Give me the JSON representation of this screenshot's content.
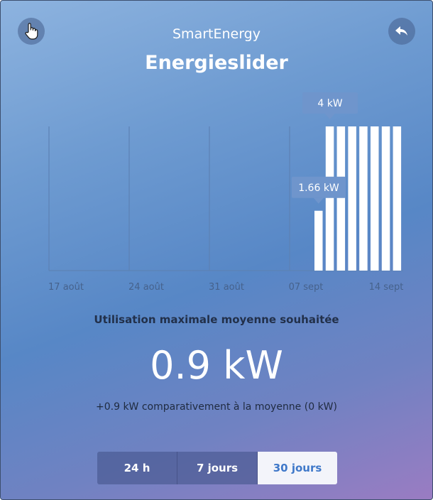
{
  "header": {
    "app_name": "SmartEnergy",
    "title": "Energieslider",
    "left_icon": "hand-pointer-icon",
    "right_icon": "back-arrow-icon"
  },
  "chart_data": {
    "type": "bar",
    "x_tick_labels": [
      "17 août",
      "24 août",
      "31 août",
      "07 sept",
      "14 sept"
    ],
    "values": [
      1.66,
      4,
      4,
      4,
      4,
      4,
      4,
      4
    ],
    "ylim": [
      0,
      4.4
    ],
    "annotations": [
      {
        "label": "4 kW",
        "bar_index": 1
      },
      {
        "label": "1.66 kW",
        "bar_index": 0
      }
    ],
    "grid": "vertical",
    "bar_color": "#ffffff"
  },
  "summary": {
    "label": "Utilisation maximale moyenne souhaitée",
    "value": "0.9 kW",
    "comparison": "+0.9 kW comparativement à la moyenne (0 kW)"
  },
  "tabs": {
    "items": [
      {
        "label": "24 h",
        "active": false
      },
      {
        "label": "7 jours",
        "active": false
      },
      {
        "label": "30 jours",
        "active": true
      }
    ]
  },
  "colors": {
    "accent": "#3f78c9",
    "tooltip": "#6f95cc",
    "grid": "#5d82b5"
  }
}
